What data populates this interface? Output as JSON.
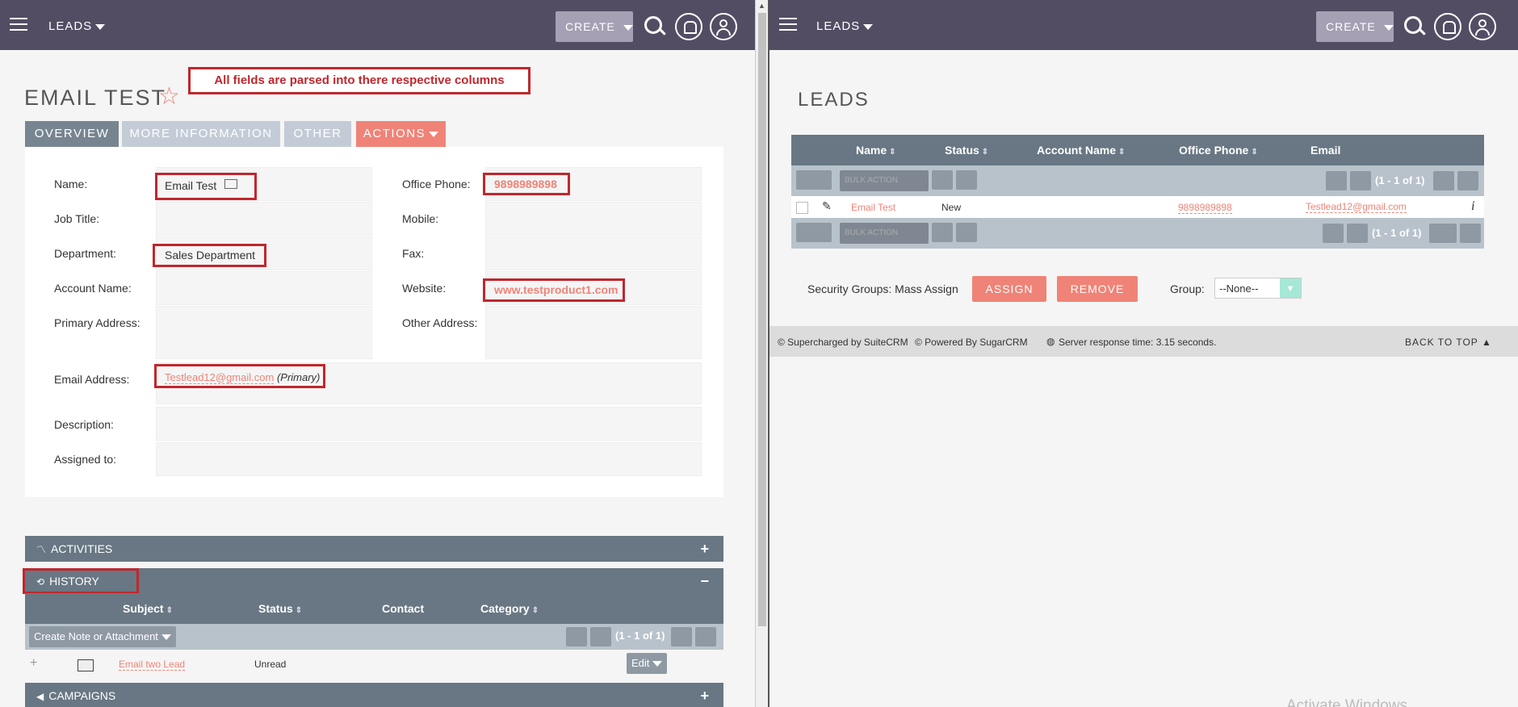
{
  "left": {
    "nav": {
      "module": "LEADS",
      "create": "CREATE"
    },
    "record": {
      "title": "EMAIL TEST",
      "callout": "All fields are parsed into there respective columns",
      "tabs": [
        "OVERVIEW",
        "MORE INFORMATION",
        "OTHER",
        "ACTIONS"
      ],
      "fields": {
        "name_label": "Name:",
        "name_value": "Email Test",
        "office_phone_label": "Office Phone:",
        "office_phone_value": "9898989898",
        "job_title_label": "Job Title:",
        "mobile_label": "Mobile:",
        "department_label": "Department:",
        "department_value": "Sales Department",
        "fax_label": "Fax:",
        "account_name_label": "Account Name:",
        "website_label": "Website:",
        "website_value": "www.testproduct1.com",
        "primary_address_label": "Primary Address:",
        "other_address_label": "Other Address:",
        "email_label": "Email Address:",
        "email_value": "Testlead12@gmail.com",
        "email_primary": "(Primary)",
        "description_label": "Description:",
        "assigned_label": "Assigned to:"
      }
    },
    "subpanels": {
      "activities": "ACTIVITIES",
      "history": "HISTORY",
      "campaigns": "CAMPAIGNS",
      "history_columns": [
        "Subject",
        "Status",
        "Contact",
        "Category"
      ],
      "create_note": "Create Note or Attachment",
      "pagination": "(1 - 1 of 1)",
      "row": {
        "subject": "Email two Lead",
        "status": "Unread",
        "edit": "Edit"
      }
    }
  },
  "right": {
    "nav": {
      "module": "LEADS",
      "create": "CREATE"
    },
    "title": "LEADS",
    "columns": [
      "Name",
      "Status",
      "Account Name",
      "Office Phone",
      "Email"
    ],
    "bulk_action": "BULK ACTION",
    "pagination": "(1 - 1 of 1)",
    "row": {
      "name": "Email Test",
      "status": "New",
      "office_phone": "9898989898",
      "email": "Testlead12@gmail.com",
      "info": "i"
    },
    "security": {
      "label": "Security Groups: Mass Assign",
      "assign": "ASSIGN",
      "remove": "REMOVE",
      "group_label": "Group:",
      "group_value": "--None--"
    },
    "footer": {
      "suite": "© Supercharged by SuiteCRM",
      "sugar": "© Powered By SugarCRM",
      "response": "Server response time: 3.15 seconds.",
      "back_to_top": "BACK TO TOP"
    },
    "watermark": "Activate Windows"
  },
  "colors": {
    "nav": "#534d64",
    "accent": "#f08377",
    "annotation": "#c0272d",
    "subpanel": "#687783"
  }
}
